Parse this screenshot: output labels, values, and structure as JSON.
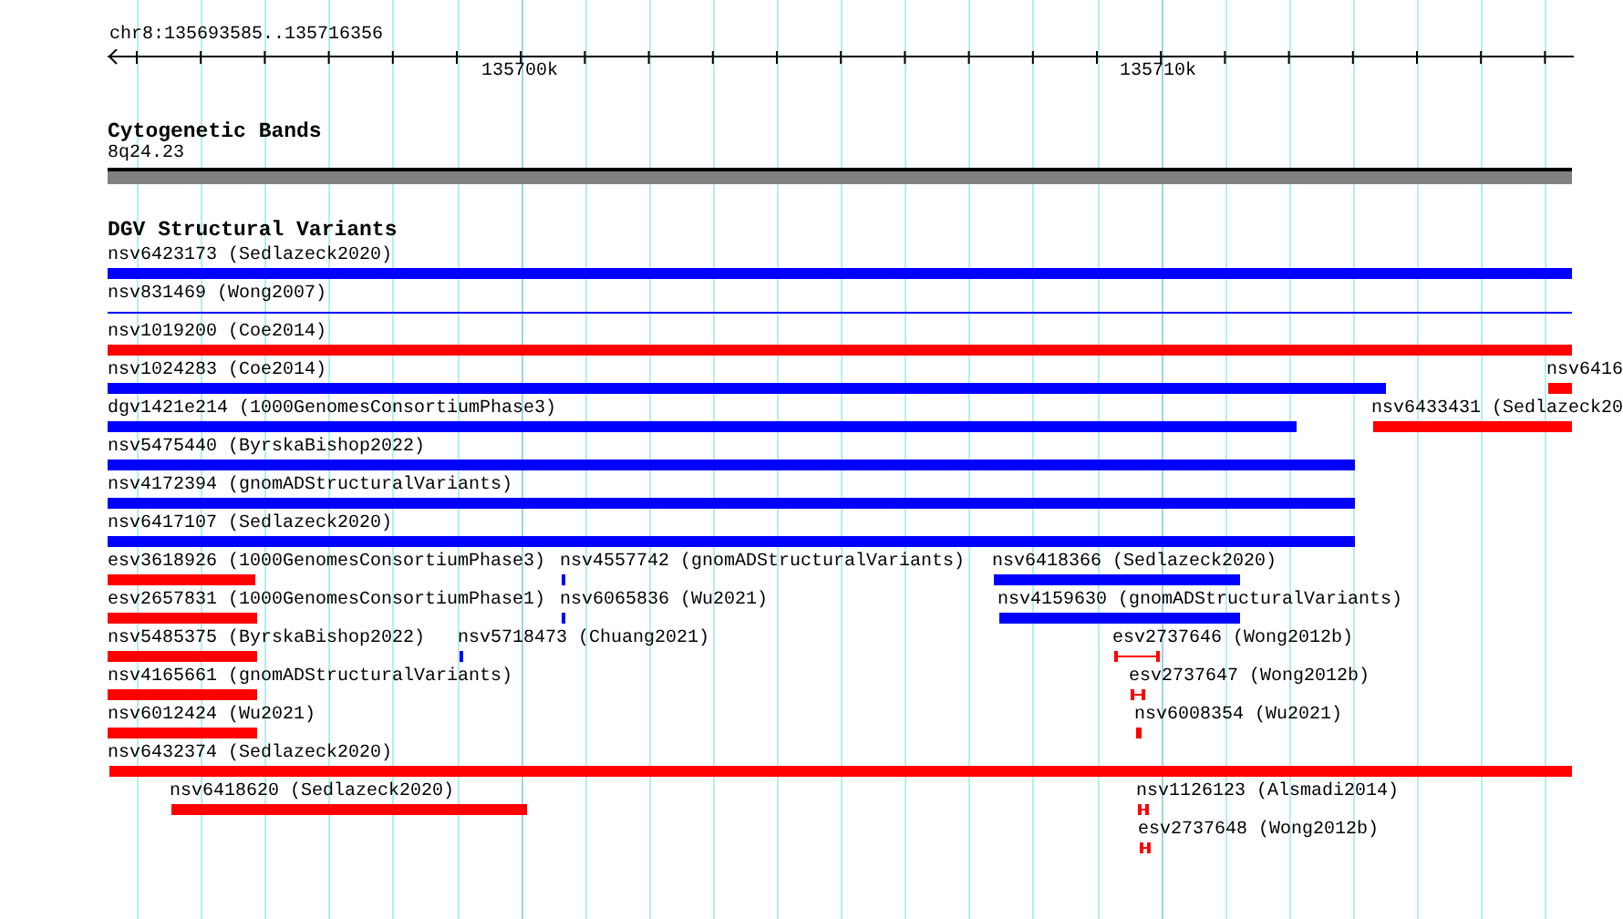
{
  "location": "chr8:135693585..135716356",
  "ruler": {
    "labels": [
      "135700k",
      "135710k"
    ]
  },
  "tracks": [
    {
      "title": "Cytogenetic Bands",
      "kind": "bands",
      "features": [
        {
          "label": "8q24.23"
        }
      ]
    },
    {
      "title": "DGV Structural Variants",
      "kind": "variants",
      "features": [
        {
          "label": "nsv6423173 (Sedlazeck2020)",
          "color": "#0000ff",
          "kind": "bar"
        },
        {
          "label": "nsv831469 (Wong2007)",
          "color": "#0000ff",
          "kind": "line"
        },
        {
          "label": "nsv1019200 (Coe2014)",
          "color": "#ff0000",
          "kind": "bar"
        },
        {
          "label": "nsv1024283 (Coe2014)",
          "color": "#0000ff",
          "kind": "bar"
        },
        {
          "label": "nsv6416",
          "color": "#ff0000",
          "kind": "bar"
        },
        {
          "label": "dgv1421e214 (1000GenomesConsortiumPhase3)",
          "color": "#0000ff",
          "kind": "bar"
        },
        {
          "label": "nsv6433431 (Sedlazeck20",
          "color": "#ff0000",
          "kind": "bar"
        },
        {
          "label": "nsv5475440 (ByrskaBishop2022)",
          "color": "#0000ff",
          "kind": "bar"
        },
        {
          "label": "nsv4172394 (gnomADStructuralVariants)",
          "color": "#0000ff",
          "kind": "bar"
        },
        {
          "label": "nsv6417107 (Sedlazeck2020)",
          "color": "#0000ff",
          "kind": "bar"
        },
        {
          "label": "esv3618926 (1000GenomesConsortiumPhase3)",
          "color": "#ff0000",
          "kind": "bar"
        },
        {
          "label": "nsv4557742 (gnomADStructuralVariants)",
          "color": "#0000ff",
          "kind": "bar"
        },
        {
          "label": "nsv6418366 (Sedlazeck2020)",
          "color": "#0000ff",
          "kind": "bar"
        },
        {
          "label": "esv2657831 (1000GenomesConsortiumPhase1)",
          "color": "#ff0000",
          "kind": "bar"
        },
        {
          "label": "nsv6065836 (Wu2021)",
          "color": "#0000ff",
          "kind": "bar"
        },
        {
          "label": "nsv4159630 (gnomADStructuralVariants)",
          "color": "#0000ff",
          "kind": "bar"
        },
        {
          "label": "nsv5485375 (ByrskaBishop2022)",
          "color": "#ff0000",
          "kind": "bar"
        },
        {
          "label": "nsv5718473 (Chuang2021)",
          "color": "#0000ff",
          "kind": "bar"
        },
        {
          "label": "esv2737646 (Wong2012b)",
          "color": "#ff0000",
          "kind": "whisker"
        },
        {
          "label": "nsv4165661 (gnomADStructuralVariants)",
          "color": "#ff0000",
          "kind": "bar"
        },
        {
          "label": "esv2737647 (Wong2012b)",
          "color": "#ff0000",
          "kind": "whisker"
        },
        {
          "label": "nsv6012424 (Wu2021)",
          "color": "#ff0000",
          "kind": "bar"
        },
        {
          "label": "nsv6008354 (Wu2021)",
          "color": "#ff0000",
          "kind": "bar"
        },
        {
          "label": "nsv6432374 (Sedlazeck2020)",
          "color": "#ff0000",
          "kind": "bar"
        },
        {
          "label": "nsv6418620 (Sedlazeck2020)",
          "color": "#ff0000",
          "kind": "bar"
        },
        {
          "label": "nsv1126123 (Alsmadi2014)",
          "color": "#ff0000",
          "kind": "whisker"
        },
        {
          "label": "esv2737648 (Wong2012b)",
          "color": "#ff0000",
          "kind": "whisker"
        }
      ]
    }
  ]
}
